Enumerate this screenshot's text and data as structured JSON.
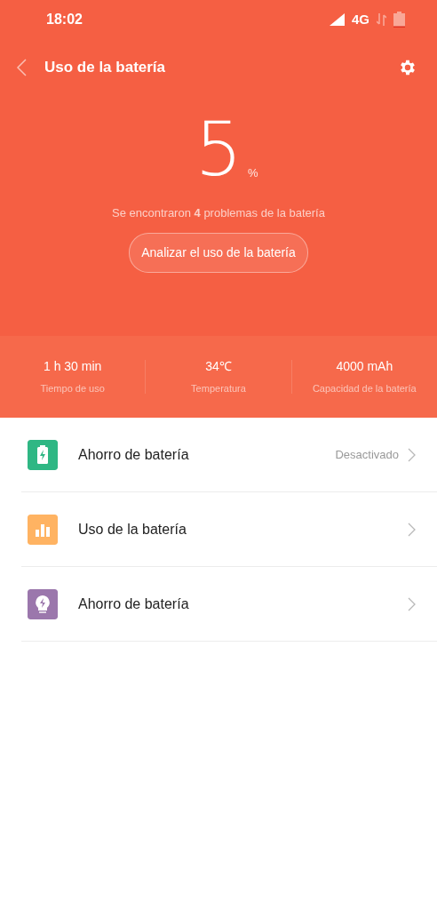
{
  "status_bar": {
    "time": "18:02",
    "network": "4G"
  },
  "header": {
    "title": "Uso de la batería"
  },
  "hero": {
    "percent": "5",
    "unit": "%",
    "message": "Se encontraron **4** problemas de la batería",
    "button": "Analizar el uso de la batería"
  },
  "stats": [
    {
      "value": "1 h 30 min",
      "label": "Tiempo de uso"
    },
    {
      "value": "34℃",
      "label": "Temperatura"
    },
    {
      "value": "4000 mAh",
      "label": "Capacidad de la batería"
    }
  ],
  "items": [
    {
      "kind": "battery",
      "color": "#2fb784",
      "label": "Ahorro de batería",
      "value": "Desactivado"
    },
    {
      "kind": "chart",
      "color": "#ffb362",
      "label": "Uso de la batería"
    },
    {
      "kind": "bulb",
      "color": "#9b77ac",
      "label": "Ahorro de batería"
    }
  ]
}
